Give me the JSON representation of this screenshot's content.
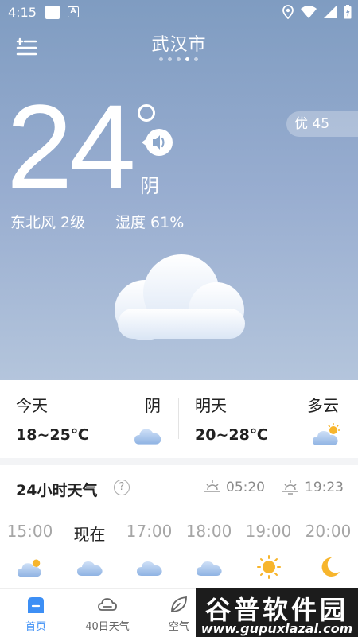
{
  "status_bar": {
    "time": "4:15",
    "app_badge": "A"
  },
  "header": {
    "city": "武汉市",
    "page_dot_count": 5,
    "active_dot": 3
  },
  "current": {
    "temperature": "24",
    "condition": "阴",
    "wind": "东北风 2级",
    "humidity": "湿度 61%",
    "aqi": "优 45"
  },
  "forecast": {
    "today": {
      "label": "今天",
      "condition": "阴",
      "range": "18~25℃",
      "icon": "cloudy-icon"
    },
    "tomorrow": {
      "label": "明天",
      "condition": "多云",
      "range": "20~28℃",
      "icon": "partly-cloudy-icon"
    }
  },
  "hourly": {
    "title": "24小时天气",
    "help": "?",
    "sunrise": "05:20",
    "sunset": "19:23",
    "hours": [
      {
        "label": "15:00",
        "icon": "partly-cloudy-icon"
      },
      {
        "label": "现在",
        "icon": "cloudy-icon"
      },
      {
        "label": "17:00",
        "icon": "cloudy-icon"
      },
      {
        "label": "18:00",
        "icon": "cloudy-icon"
      },
      {
        "label": "19:00",
        "icon": "sun-icon"
      },
      {
        "label": "20:00",
        "icon": "moon-icon"
      }
    ]
  },
  "nav": {
    "items": [
      {
        "label": "首页",
        "icon": "home-icon",
        "active": true
      },
      {
        "label": "40日天气",
        "icon": "cloud-outline-icon",
        "active": false
      },
      {
        "label": "空气",
        "icon": "leaf-icon",
        "active": false
      }
    ]
  },
  "watermark": {
    "title": "谷普软件园",
    "url": "www.gupuxlazal.com"
  },
  "colors": {
    "hero_top": "#7f9cc1",
    "hero_bottom": "#b4c5dc",
    "accent": "#3d8ff5",
    "sun": "#f7b52c"
  }
}
